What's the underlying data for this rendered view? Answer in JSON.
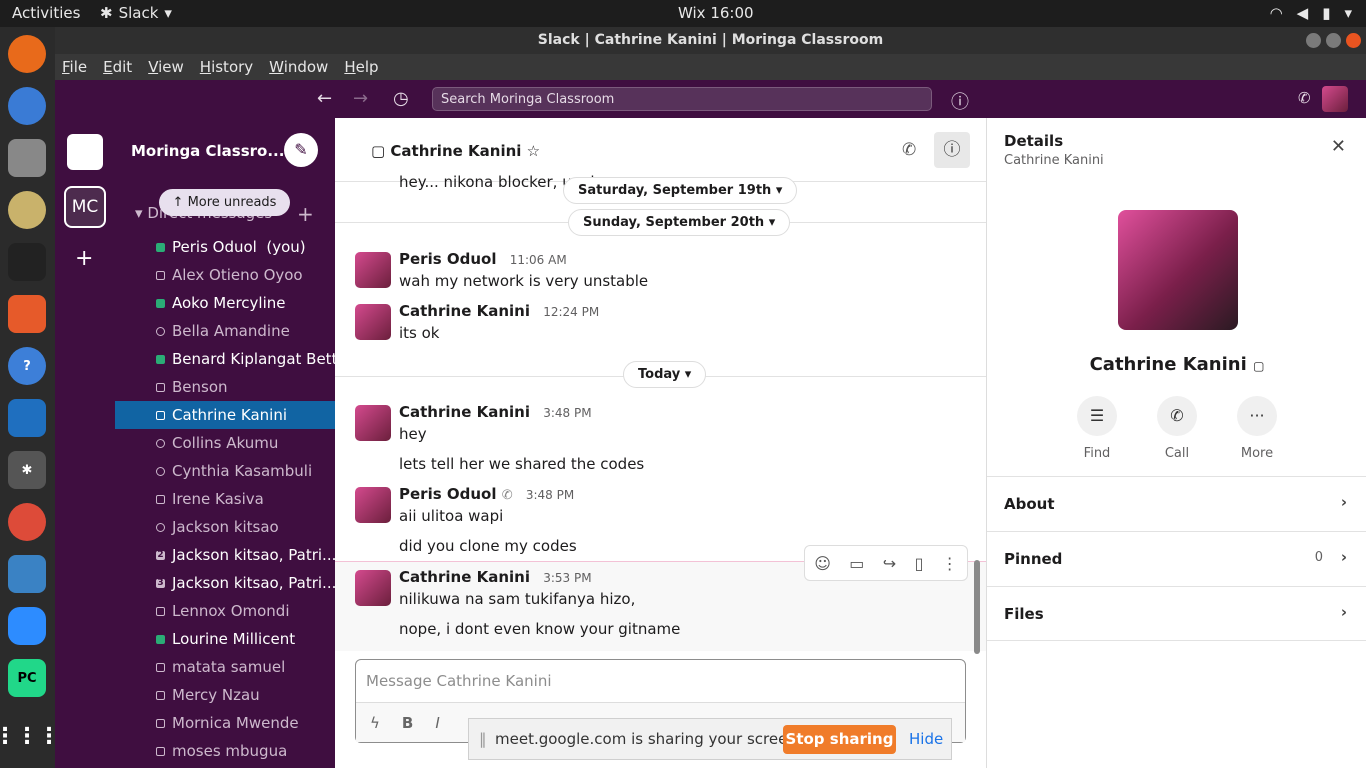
{
  "topbar": {
    "activities": "Activities",
    "app_name": "Slack",
    "clock": "Wix 16:00"
  },
  "window": {
    "title": "Slack | Cathrine Kanini | Moringa Classroom"
  },
  "menu": [
    "File",
    "Edit",
    "View",
    "History",
    "Window",
    "Help"
  ],
  "header": {
    "search_placeholder": "Search Moringa Classroom"
  },
  "rail": {
    "workspace_abbr": "MC"
  },
  "sidebar": {
    "workspace": "Moringa Classro...",
    "more_unreads": "More unreads",
    "section": "Direct messages",
    "dms": [
      {
        "name": "Peris Oduol",
        "suffix": "(you)",
        "status": "on"
      },
      {
        "name": "Alex Otieno Oyoo",
        "status": "off"
      },
      {
        "name": "Aoko Mercyline",
        "status": "on"
      },
      {
        "name": "Bella Amandine",
        "status": "circ"
      },
      {
        "name": "Benard Kiplangat Bett",
        "status": "on"
      },
      {
        "name": "Benson",
        "status": "off"
      },
      {
        "name": "Cathrine Kanini",
        "status": "off"
      },
      {
        "name": "Collins Akumu",
        "status": "circ"
      },
      {
        "name": "Cynthia Kasambuli",
        "status": "circ"
      },
      {
        "name": "Irene Kasiva",
        "status": "off"
      },
      {
        "name": "Jackson kitsao",
        "status": "circ"
      },
      {
        "name": "Jackson kitsao, Patri...",
        "status": "num",
        "count": "2"
      },
      {
        "name": "Jackson kitsao, Patri...",
        "status": "num",
        "count": "3"
      },
      {
        "name": "Lennox Omondi",
        "status": "off"
      },
      {
        "name": "Lourine Millicent",
        "status": "on"
      },
      {
        "name": "matata samuel",
        "status": "off"
      },
      {
        "name": "Mercy Nzau",
        "status": "off"
      },
      {
        "name": "Mornica Mwende",
        "status": "off"
      },
      {
        "name": "moses mbugua",
        "status": "off"
      }
    ]
  },
  "channel": {
    "name": "Cathrine Kanini",
    "clipped_text": "hey... nikona blocker, unal",
    "dates": [
      "Saturday, September 19th",
      "Sunday, September 20th",
      "Today"
    ],
    "messages": [
      {
        "author": "Peris Oduol",
        "time": "11:06 AM",
        "lines": [
          "wah my network is very unstable"
        ]
      },
      {
        "author": "Cathrine Kanini",
        "time": "12:24 PM",
        "lines": [
          "its ok"
        ]
      },
      {
        "author": "Cathrine Kanini",
        "time": "3:48 PM",
        "lines": [
          "hey",
          "lets tell her we shared the codes"
        ]
      },
      {
        "author": "Peris Oduol",
        "time": "3:48 PM",
        "lines": [
          "aii ulitoa wapi",
          "did you clone my codes"
        ]
      },
      {
        "author": "Cathrine Kanini",
        "time": "3:53 PM",
        "lines": [
          "nilikuwa na sam tukifanya hizo,",
          "nope, i dont even know your gitname"
        ]
      }
    ],
    "composer_placeholder": "Message Cathrine Kanini"
  },
  "share": {
    "text": "meet.google.com is sharing your screen.",
    "stop": "Stop sharing",
    "hide": "Hide"
  },
  "details": {
    "title": "Details",
    "subtitle": "Cathrine Kanini",
    "name": "Cathrine Kanini",
    "actions": [
      "Find",
      "Call",
      "More"
    ],
    "rows": [
      {
        "label": "About"
      },
      {
        "label": "Pinned",
        "count": "0"
      },
      {
        "label": "Files"
      }
    ]
  }
}
